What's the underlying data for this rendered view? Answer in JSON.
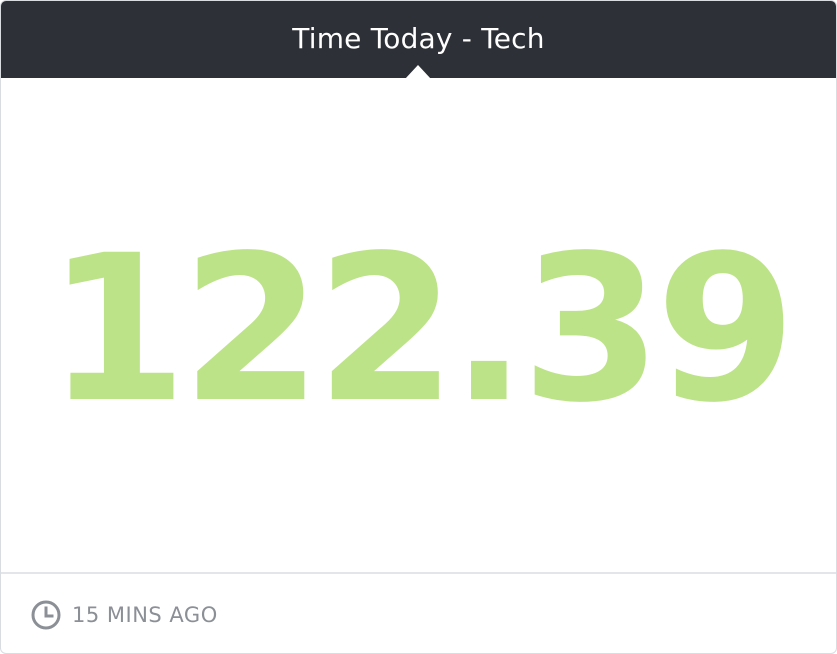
{
  "widget": {
    "title": "Time Today - Tech",
    "value": "122.39",
    "updated": "15 MINS AGO"
  },
  "icons": {
    "clock": "clock-icon"
  },
  "colors": {
    "header_bg": "#2d3037",
    "title_text": "#ffffff",
    "value_text": "#bde388",
    "footer_text": "#8b8f96"
  }
}
